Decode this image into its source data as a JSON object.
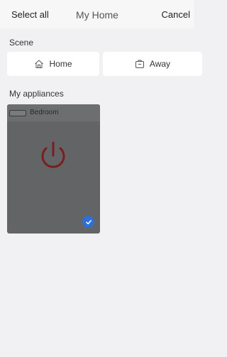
{
  "header": {
    "select_all_label": "Select all",
    "title": "My Home",
    "cancel_label": "Cancel"
  },
  "scene": {
    "label": "Scene",
    "buttons": [
      {
        "label": "Home",
        "icon": "home-icon"
      },
      {
        "label": "Away",
        "icon": "suitcase-icon"
      }
    ]
  },
  "appliances": {
    "label": "My appliances",
    "items": [
      {
        "name": "Bedroom",
        "icon": "air-conditioner-icon",
        "power_state": "off",
        "selected": true
      }
    ]
  },
  "colors": {
    "background": "#f1f1f3",
    "card": "#636466",
    "power_icon": "#7a1f1f",
    "check_badge": "#2e6fd6"
  }
}
